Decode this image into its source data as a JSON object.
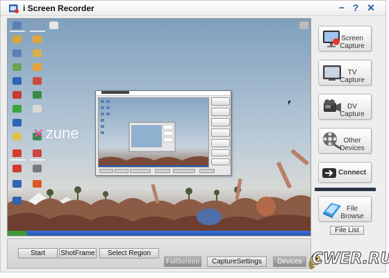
{
  "window": {
    "title": "i Screen Recorder",
    "minimize_symbol": "−",
    "help_symbol": "?",
    "close_symbol": "✕"
  },
  "preview": {
    "logo_text": "zune",
    "logo_mark": "✕"
  },
  "sidebar": {
    "screen_capture": {
      "line1": "Screen",
      "line2": "Capture",
      "icon": "monitor-capture-icon"
    },
    "tv_capture": {
      "line1": "TV",
      "line2": "Capture",
      "icon": "tv-icon"
    },
    "dv_capture": {
      "line1": "DV",
      "line2": "Capture",
      "icon": "camcorder-icon"
    },
    "other_devices": {
      "line1": "Other",
      "line2": "Devices",
      "icon": "film-reel-icon"
    },
    "connect": {
      "label": "Connect",
      "icon": "arrow-right-icon"
    },
    "file_browse": {
      "line1": "File",
      "line2": "Browse",
      "icon": "folder-icon"
    },
    "file_list": "File List"
  },
  "bottom": {
    "start": "Start",
    "shotframe": "ShotFrame",
    "select_region": "Select Region",
    "fullscreen": "FullScreen",
    "capture_settings": "CaptureSettings",
    "devices": "Devices"
  },
  "watermark": "CWER.RU",
  "colors": {
    "accent": "#1f5fa8",
    "taskbar": "#2456b8",
    "sky": "#93aec5"
  }
}
